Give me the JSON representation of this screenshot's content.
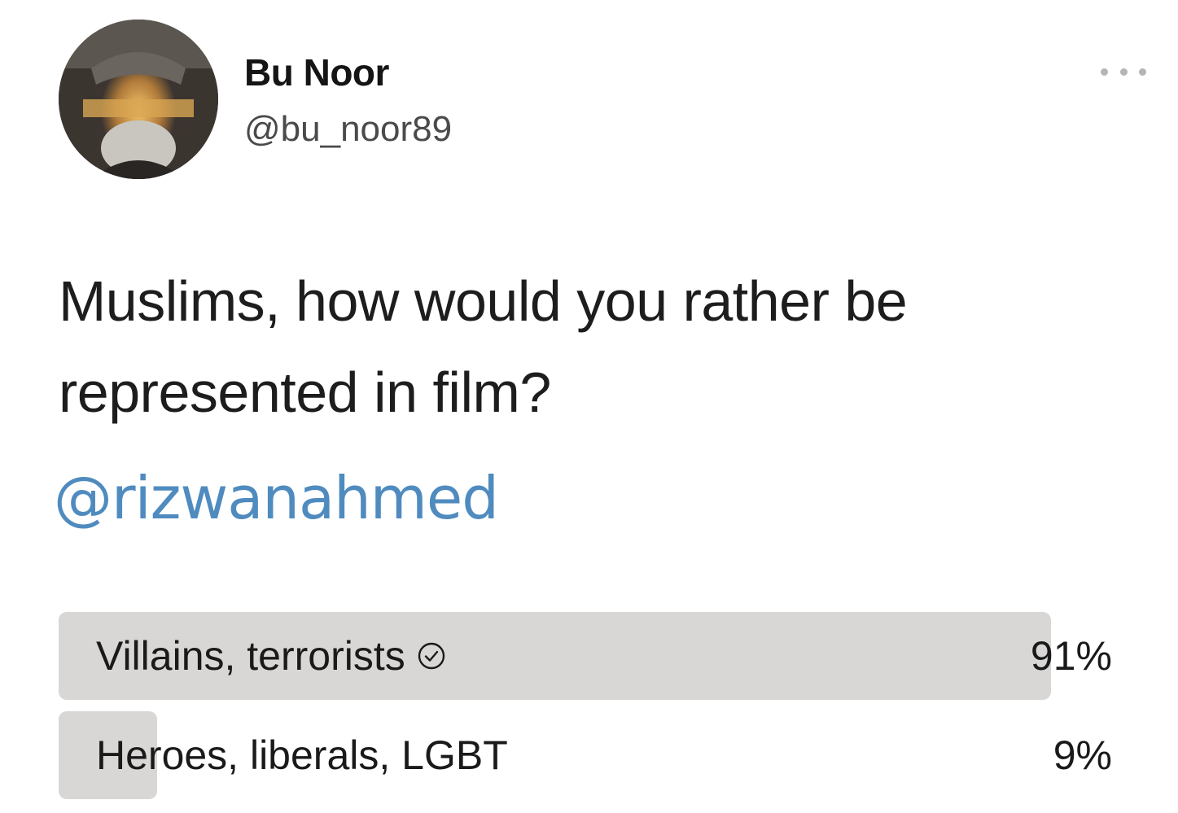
{
  "tweet": {
    "display_name": "Bu Noor",
    "handle": "@bu_noor89",
    "question": "Muslims, how would you rather be represented in film?",
    "mention": "@rizwanahmed",
    "icons": {
      "more": "more-horizontal-icon",
      "check": "check-circle-icon"
    }
  },
  "poll": {
    "options": [
      {
        "label": "Villains, terrorists",
        "percent": "91%",
        "value": 0.91,
        "selected": true
      },
      {
        "label": "Heroes, liberals, LGBT",
        "percent": "9%",
        "value": 0.09,
        "selected": false
      }
    ],
    "colors": {
      "bar_fill": "#d9d7d5",
      "mention": "#4f8bbf"
    }
  }
}
